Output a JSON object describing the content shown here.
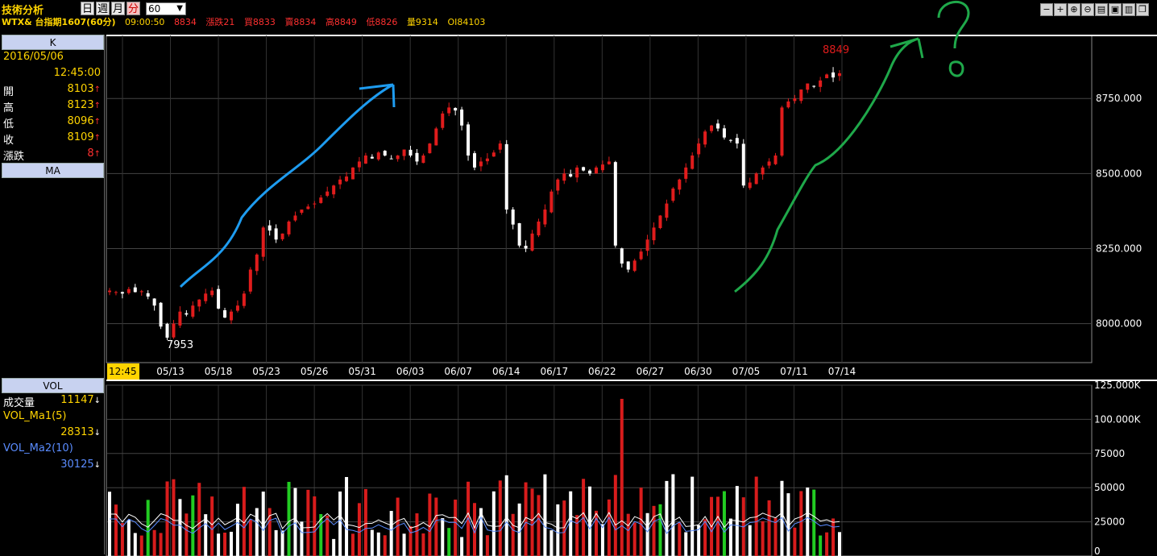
{
  "app": {
    "title": "技術分析"
  },
  "period_buttons": [
    "日",
    "週",
    "月",
    "分"
  ],
  "interval": "60",
  "quote": {
    "symbol": "WTX& 台指期1607(60分)",
    "time": "09:00:50",
    "last": "8834",
    "change": "漲跌21",
    "bid": "買8833",
    "ask": "賣8834",
    "high": "高8849",
    "low": "低8826",
    "volume": "量9314",
    "oi": "OI84103"
  },
  "window_buttons": [
    "minus",
    "plus",
    "zoom-in",
    "zoom-out",
    "print",
    "copy",
    "save",
    "restore",
    "close"
  ],
  "k_panel": {
    "header": "K",
    "date": "2016/05/06",
    "time": "12:45:00",
    "rows": [
      {
        "label": "開",
        "value": "8103",
        "dir": "up"
      },
      {
        "label": "高",
        "value": "8123",
        "dir": "up"
      },
      {
        "label": "低",
        "value": "8096",
        "dir": "up"
      },
      {
        "label": "收",
        "value": "8109",
        "dir": "up"
      },
      {
        "label": "漲跌",
        "value": "8",
        "dir": "up"
      }
    ]
  },
  "ma_panel": {
    "header": "MA"
  },
  "vol_panel": {
    "header": "VOL",
    "rows": [
      {
        "label": "成交量",
        "value": "11147",
        "dir": "down",
        "color": "#ffd400"
      },
      {
        "label": "VOL_Ma1(5)",
        "value": "28313",
        "dir": "down",
        "color": "#ffd400"
      },
      {
        "label": "VOL_Ma2(10)",
        "value": "30125",
        "dir": "down",
        "color": "#5a8cff"
      }
    ]
  },
  "chart_data": [
    {
      "type": "candlestick",
      "x_ticks": [
        "12:45",
        "05/13",
        "05/18",
        "05/23",
        "05/26",
        "05/31",
        "06/03",
        "06/07",
        "06/14",
        "06/17",
        "06/22",
        "06/27",
        "06/30",
        "07/05",
        "07/11",
        "07/14"
      ],
      "y_ticks": [
        "8750.000",
        "8500.000",
        "8250.000",
        "8000.000"
      ],
      "ylim": [
        7870,
        8960
      ],
      "annotations": {
        "low_label": "7953",
        "high_label": "8849"
      },
      "close_path": [
        8110,
        8105,
        8100,
        8115,
        8105,
        8108,
        8090,
        8060,
        7990,
        7953,
        8000,
        8040,
        8030,
        8060,
        8080,
        8100,
        8110,
        8050,
        8020,
        8040,
        8060,
        8100,
        8180,
        8230,
        8320,
        8310,
        8280,
        8300,
        8340,
        8360,
        8380,
        8390,
        8400,
        8420,
        8440,
        8460,
        8480,
        8490,
        8520,
        8540,
        8560,
        8550,
        8570,
        8560,
        8550,
        8560,
        8580,
        8560,
        8540,
        8560,
        8600,
        8650,
        8700,
        8720,
        8710,
        8660,
        8560,
        8520,
        8540,
        8550,
        8570,
        8600,
        8380,
        8330,
        8260,
        8250,
        8300,
        8340,
        8380,
        8440,
        8480,
        8500,
        8490,
        8520,
        8510,
        8500,
        8520,
        8530,
        8540,
        8260,
        8200,
        8180,
        8210,
        8240,
        8280,
        8320,
        8360,
        8400,
        8450,
        8480,
        8520,
        8560,
        8600,
        8640,
        8660,
        8650,
        8620,
        8610,
        8600,
        8460,
        8470,
        8500,
        8520,
        8540,
        8560,
        8720,
        8740,
        8750,
        8780,
        8800,
        8790,
        8810,
        8830,
        8820,
        8834
      ],
      "volume_ylim": [
        0,
        125000
      ],
      "volume_ticks": [
        "125.000K",
        "100.000K",
        "75000",
        "50000",
        "25000",
        "0"
      ]
    }
  ]
}
